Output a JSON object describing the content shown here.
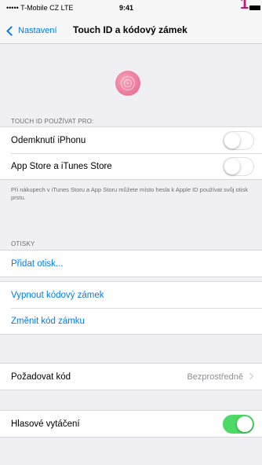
{
  "status_bar": {
    "carrier": "••••• T-Mobile CZ  LTE",
    "time": "9:41"
  },
  "nav": {
    "back_label": "Nastavení",
    "title": "Touch ID a kódový zámek"
  },
  "touch_id": {
    "section_header": "TOUCH ID POUŽÍVAT PRO:",
    "items": [
      {
        "label": "Odemknutí iPhonu",
        "toggle": "off"
      },
      {
        "label": "App Store a iTunes Store",
        "toggle": "off"
      }
    ],
    "footnote": "Při nákupech v iTunes Storu a App Storu můžete místo hesla k Apple ID používat svůj otisk prstu."
  },
  "fingerprints": {
    "section_header": "OTISKY",
    "add_label": "Přidat otisk..."
  },
  "passcode": {
    "turn_off_label": "Vypnout kódový zámek",
    "change_label": "Změnit kód zámku"
  },
  "require": {
    "label": "Požadovat kód",
    "value": "Bezprostředně"
  },
  "voice_dial": {
    "label": "Hlasové vytáčení",
    "toggle": "on"
  },
  "colors": {
    "accent": "#007aff",
    "toggle_on": "#4cd964",
    "corner_mark": "#c2187a"
  }
}
